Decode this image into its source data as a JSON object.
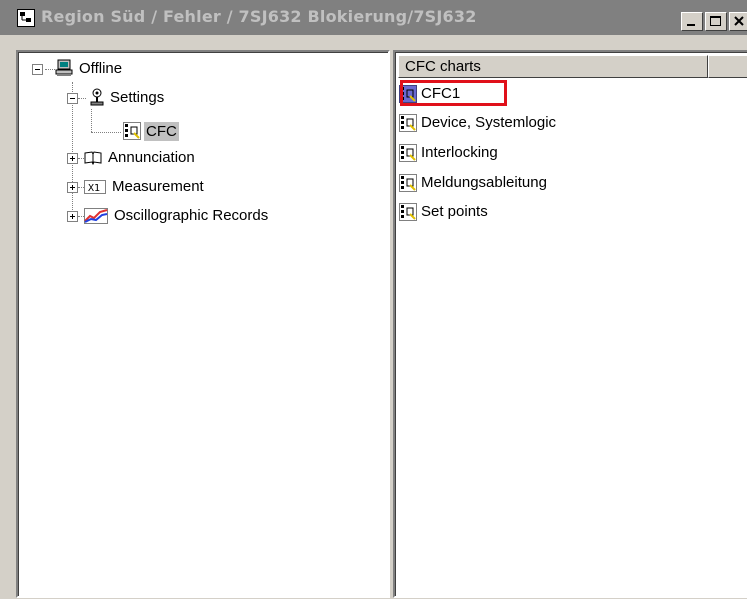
{
  "window": {
    "title": "Region Süd / Fehler / 7SJ632 Blokierung/7SJ632"
  },
  "tree": {
    "offline": "Offline",
    "settings": "Settings",
    "cfc": "CFC",
    "annunciation": "Annunciation",
    "measurement": "Measurement",
    "oscillographic": "Oscillographic Records"
  },
  "list": {
    "header": "CFC charts",
    "items": [
      {
        "label": "CFC1",
        "highlighted": true
      },
      {
        "label": "Device, Systemlogic"
      },
      {
        "label": "Interlocking"
      },
      {
        "label": "Meldungsableitung"
      },
      {
        "label": "Set points"
      }
    ]
  },
  "colors": {
    "title_bar": "#808080",
    "highlight_box": "#e0101a",
    "selection": "#c0c0c0"
  }
}
